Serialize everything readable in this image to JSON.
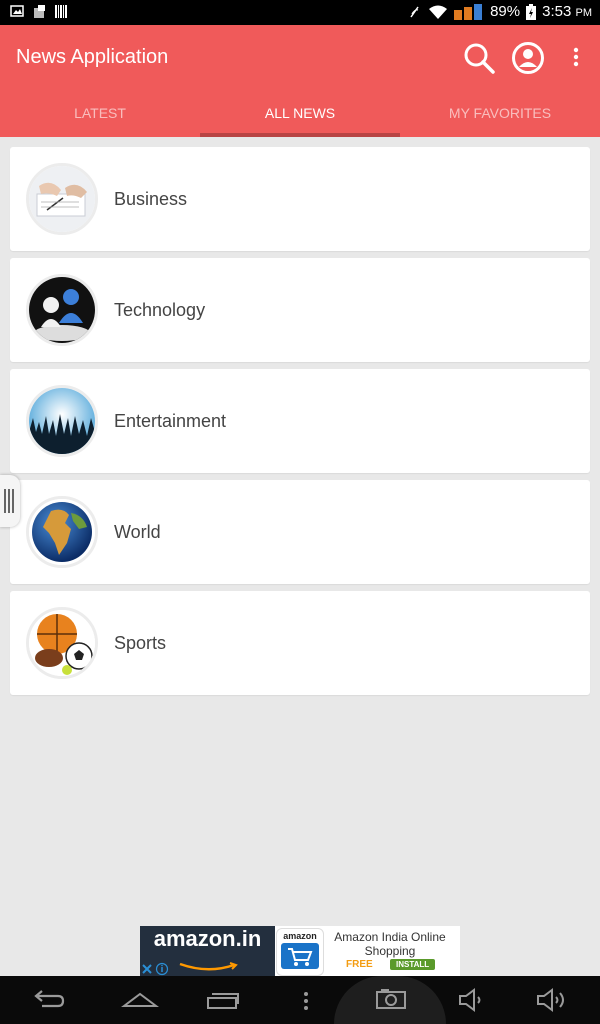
{
  "status_bar": {
    "battery": "89%",
    "time": "3:53",
    "ampm": "PM"
  },
  "app_bar": {
    "title": "News Application",
    "icons": [
      "search-icon",
      "account-icon",
      "overflow-menu-icon"
    ]
  },
  "tabs": [
    {
      "label": "LATEST",
      "active": false
    },
    {
      "label": "ALL NEWS",
      "active": true
    },
    {
      "label": "MY FAVORITES",
      "active": false
    }
  ],
  "categories": [
    {
      "label": "Business",
      "icon": "business-thumbnail"
    },
    {
      "label": "Technology",
      "icon": "technology-thumbnail"
    },
    {
      "label": "Entertainment",
      "icon": "entertainment-thumbnail"
    },
    {
      "label": "World",
      "icon": "globe-thumbnail"
    },
    {
      "label": "Sports",
      "icon": "sports-balls-thumbnail"
    }
  ],
  "ad": {
    "brand": "amazon.in",
    "app_icon_text": "amazon",
    "app_name": "Amazon India Online Shopping",
    "price": "FREE",
    "cta": "INSTALL"
  },
  "colors": {
    "primary": "#f05a5a",
    "indicator": "#b84444",
    "background": "#e8e8e8"
  }
}
